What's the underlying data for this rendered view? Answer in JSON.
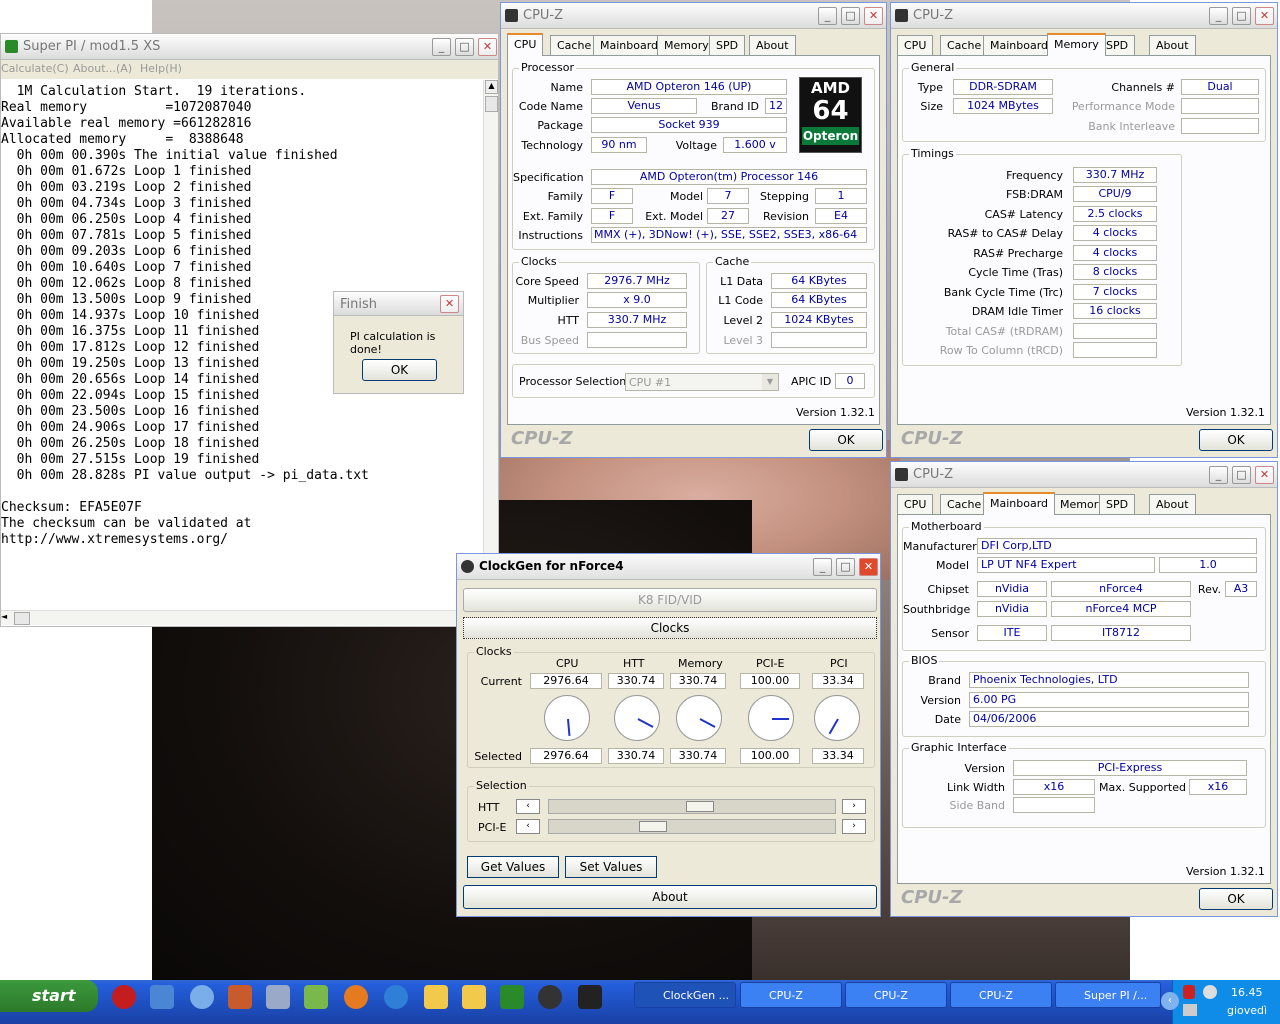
{
  "superpi": {
    "title": "Super PI / mod1.5 XS",
    "menu": [
      "Calculate(C)",
      "About...(A)",
      "Help(H)"
    ],
    "lines": [
      "  1M Calculation Start.  19 iterations.",
      "Real memory          =1072087040",
      "Available real memory =661282816",
      "Allocated memory     =  8388648",
      "  0h 00m 00.390s The initial value finished",
      "  0h 00m 01.672s Loop 1 finished",
      "  0h 00m 03.219s Loop 2 finished",
      "  0h 00m 04.734s Loop 3 finished",
      "  0h 00m 06.250s Loop 4 finished",
      "  0h 00m 07.781s Loop 5 finished",
      "  0h 00m 09.203s Loop 6 finished",
      "  0h 00m 10.640s Loop 7 finished",
      "  0h 00m 12.062s Loop 8 finished",
      "  0h 00m 13.500s Loop 9 finished",
      "  0h 00m 14.937s Loop 10 finished",
      "  0h 00m 16.375s Loop 11 finished",
      "  0h 00m 17.812s Loop 12 finished",
      "  0h 00m 19.250s Loop 13 finished",
      "  0h 00m 20.656s Loop 14 finished",
      "  0h 00m 22.094s Loop 15 finished",
      "  0h 00m 23.500s Loop 16 finished",
      "  0h 00m 24.906s Loop 17 finished",
      "  0h 00m 26.250s Loop 18 finished",
      "  0h 00m 27.515s Loop 19 finished",
      "  0h 00m 28.828s PI value output -> pi_data.txt",
      "",
      "Checksum: EFA5E07F",
      "The checksum can be validated at",
      "http://www.xtremesystems.org/"
    ]
  },
  "finish": {
    "title": "Finish",
    "message": "PI calculation is done!",
    "ok": "OK"
  },
  "tabs": [
    "CPU",
    "Cache",
    "Mainboard",
    "Memory",
    "SPD",
    "About"
  ],
  "cpuz_common": {
    "title": "CPU-Z",
    "version": "Version 1.32.1",
    "logo": "CPU-Z",
    "ok": "OK"
  },
  "cpu": {
    "processor_group": "Processor",
    "name_l": "Name",
    "name": "AMD Opteron 146 (UP)",
    "code_l": "Code Name",
    "code": "Venus",
    "brand_l": "Brand ID",
    "brand": "12",
    "package_l": "Package",
    "package": "Socket 939",
    "tech_l": "Technology",
    "tech": "90 nm",
    "voltage_l": "Voltage",
    "voltage": "1.600 v",
    "spec_l": "Specification",
    "spec": "AMD Opteron(tm) Processor 146",
    "family_l": "Family",
    "family": "F",
    "model_l": "Model",
    "model": "7",
    "stepping_l": "Stepping",
    "stepping": "1",
    "extfam_l": "Ext. Family",
    "extfam": "F",
    "extmod_l": "Ext. Model",
    "extmod": "27",
    "rev_l": "Revision",
    "rev": "E4",
    "instr_l": "Instructions",
    "instr": "MMX (+), 3DNow! (+), SSE, SSE2, SSE3, x86-64",
    "clocks_group": "Clocks",
    "core_l": "Core Speed",
    "core": "2976.7 MHz",
    "mult_l": "Multiplier",
    "mult": "x 9.0",
    "htt_l": "HTT",
    "htt": "330.7 MHz",
    "bus_l": "Bus Speed",
    "bus": "",
    "cache_group": "Cache",
    "l1d_l": "L1 Data",
    "l1d": "64 KBytes",
    "l1c_l": "L1 Code",
    "l1c": "64 KBytes",
    "l2_l": "Level 2",
    "l2": "1024 KBytes",
    "l3_l": "Level 3",
    "l3": "",
    "procsel_l": "Processor Selection",
    "procsel": "CPU #1",
    "apic_l": "APIC ID",
    "apic": "0",
    "logo_top": "AMD",
    "logo_mid": "64",
    "logo_bot": "Opteron"
  },
  "memory": {
    "general": "General",
    "type_l": "Type",
    "type": "DDR-SDRAM",
    "size_l": "Size",
    "size": "1024 MBytes",
    "channels_l": "Channels #",
    "channels": "Dual",
    "perf_l": "Performance Mode",
    "bank_l": "Bank Interleave",
    "timings": "Timings",
    "freq_l": "Frequency",
    "freq": "330.7 MHz",
    "fsb_l": "FSB:DRAM",
    "fsb": "CPU/9",
    "cas_l": "CAS# Latency",
    "cas": "2.5 clocks",
    "rcd_l": "RAS# to CAS# Delay",
    "rcd": "4 clocks",
    "rp_l": "RAS# Precharge",
    "rp": "4 clocks",
    "tras_l": "Cycle Time (Tras)",
    "tras": "8 clocks",
    "trc_l": "Bank Cycle Time (Trc)",
    "trc": "7 clocks",
    "idle_l": "DRAM Idle Timer",
    "idle": "16 clocks",
    "tcas_l": "Total CAS# (tRDRAM)",
    "rtc_l": "Row To Column (tRCD)"
  },
  "mainboard": {
    "mb_group": "Motherboard",
    "mfr_l": "Manufacturer",
    "mfr": "DFI Corp,LTD",
    "model_l": "Model",
    "model": "LP UT NF4 Expert",
    "model_rev": "1.0",
    "chipset_l": "Chipset",
    "chipset_v": "nVidia",
    "chipset_n": "nForce4",
    "rev_l": "Rev.",
    "rev": "A3",
    "sb_l": "Southbridge",
    "sb_v": "nVidia",
    "sb_n": "nForce4 MCP",
    "sensor_l": "Sensor",
    "sensor_v": "ITE",
    "sensor_n": "IT8712",
    "bios_group": "BIOS",
    "brand_l": "Brand",
    "brand": "Phoenix Technologies, LTD",
    "ver_l": "Version",
    "ver": "6.00 PG",
    "date_l": "Date",
    "date": "04/06/2006",
    "gi_group": "Graphic Interface",
    "giver_l": "Version",
    "giver": "PCI-Express",
    "lw_l": "Link Width",
    "lw": "x16",
    "maxs_l": "Max. Supported",
    "maxs": "x16",
    "sb2_l": "Side Band"
  },
  "clockgen": {
    "title": "ClockGen for nForce4",
    "k8btn": "K8 FID/VID",
    "clocksbtn": "Clocks",
    "clocks_group": "Clocks",
    "cols": [
      "CPU",
      "HTT",
      "Memory",
      "PCI-E",
      "PCI"
    ],
    "current_l": "Current",
    "current": [
      "2976.64",
      "330.74",
      "330.74",
      "100.00",
      "33.34"
    ],
    "selected_l": "Selected",
    "selected": [
      "2976.64",
      "330.74",
      "330.74",
      "100.00",
      "33.34"
    ],
    "selection_group": "Selection",
    "htt_l": "HTT",
    "pcie_l": "PCI-E",
    "htt_pos": 0.53,
    "pcie_pos": 0.35,
    "get": "Get Values",
    "set": "Set Values",
    "about": "About"
  },
  "taskbar": {
    "start": "start",
    "tasks": [
      "ClockGen ...",
      "CPU-Z",
      "CPU-Z",
      "CPU-Z",
      "Super PI /..."
    ],
    "time": "16.45",
    "day": "giovedì"
  }
}
